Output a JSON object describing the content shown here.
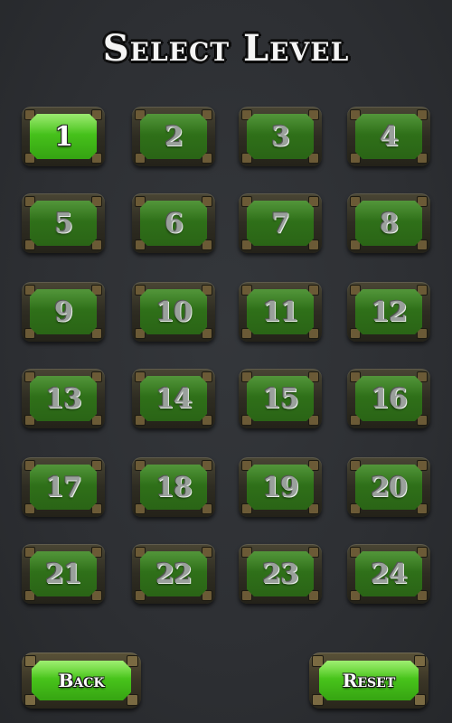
{
  "screen": {
    "title": "Select Level"
  },
  "levels": [
    {
      "number": "1",
      "unlocked": true
    },
    {
      "number": "2",
      "unlocked": false
    },
    {
      "number": "3",
      "unlocked": false
    },
    {
      "number": "4",
      "unlocked": false
    },
    {
      "number": "5",
      "unlocked": false
    },
    {
      "number": "6",
      "unlocked": false
    },
    {
      "number": "7",
      "unlocked": false
    },
    {
      "number": "8",
      "unlocked": false
    },
    {
      "number": "9",
      "unlocked": false
    },
    {
      "number": "10",
      "unlocked": false
    },
    {
      "number": "11",
      "unlocked": false
    },
    {
      "number": "12",
      "unlocked": false
    },
    {
      "number": "13",
      "unlocked": false
    },
    {
      "number": "14",
      "unlocked": false
    },
    {
      "number": "15",
      "unlocked": false
    },
    {
      "number": "16",
      "unlocked": false
    },
    {
      "number": "17",
      "unlocked": false
    },
    {
      "number": "18",
      "unlocked": false
    },
    {
      "number": "19",
      "unlocked": false
    },
    {
      "number": "20",
      "unlocked": false
    },
    {
      "number": "21",
      "unlocked": false
    },
    {
      "number": "22",
      "unlocked": false
    },
    {
      "number": "23",
      "unlocked": false
    },
    {
      "number": "24",
      "unlocked": false
    }
  ],
  "buttons": {
    "back_label": "Back",
    "reset_label": "Reset"
  },
  "colors": {
    "background": "#2e3034",
    "button_active_green": "#46c11b",
    "button_locked_green": "#2f7019",
    "frame_bronze": "#6b5a36",
    "title_white": "#f4f4f4"
  }
}
